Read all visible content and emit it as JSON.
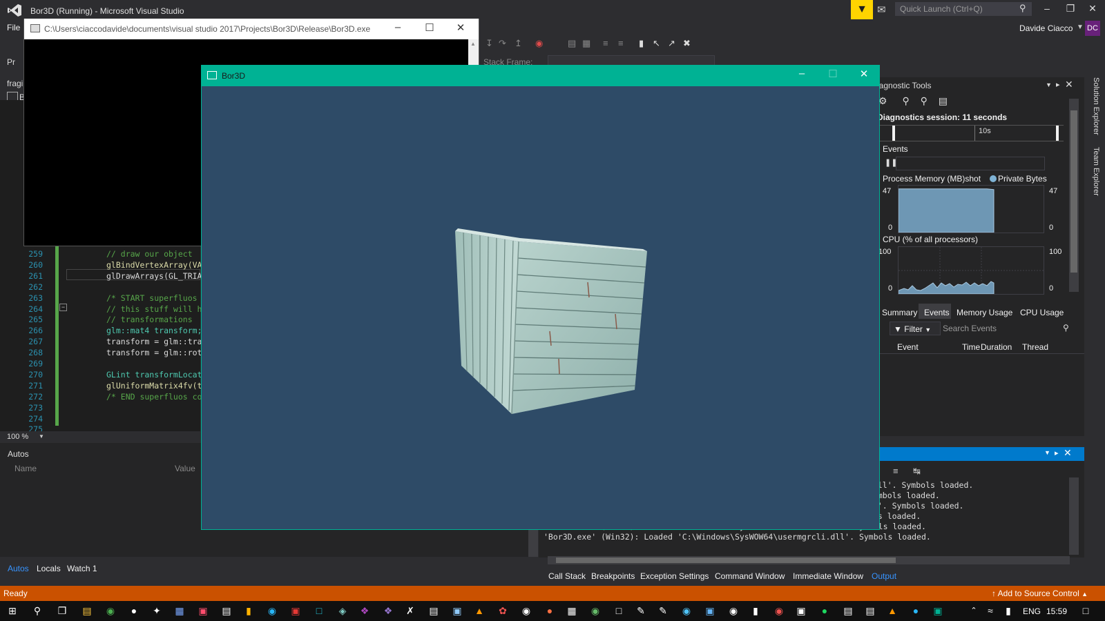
{
  "vs": {
    "title": "Bor3D (Running) - Microsoft Visual Studio",
    "quick_launch_placeholder": "Quick Launch (Ctrl+Q)",
    "menu_file": "File",
    "user_name": "Davide Ciacco",
    "user_initials": "DC",
    "stack_frame_label": "Stack Frame:",
    "left_tab_prefix": "Pr",
    "left_file_prefix": "fragi",
    "left_doc_letter": "B"
  },
  "editor": {
    "lines": [
      {
        "num": "259",
        "text": "// draw our object",
        "kind": "cmt"
      },
      {
        "num": "260",
        "text": "glBindVertexArray(VA",
        "kind": "fn"
      },
      {
        "num": "261",
        "text": "glDrawArrays(GL_TRIA",
        "kind": "plain"
      },
      {
        "num": "262",
        "text": "",
        "kind": "plain"
      },
      {
        "num": "263",
        "text": "/* START superfluos",
        "kind": "cmt"
      },
      {
        "num": "264",
        "text": "// this stuff will h",
        "kind": "cmt"
      },
      {
        "num": "265",
        "text": "// transformations",
        "kind": "cmt"
      },
      {
        "num": "266",
        "text": "glm::mat4 transform;",
        "kind": "typ"
      },
      {
        "num": "267",
        "text": "transform = glm::tra",
        "kind": "plain"
      },
      {
        "num": "268",
        "text": "transform = glm::rot",
        "kind": "plain"
      },
      {
        "num": "269",
        "text": "",
        "kind": "plain"
      },
      {
        "num": "270",
        "text": "GLint transformLocat",
        "kind": "typ"
      },
      {
        "num": "271",
        "text": "glUniformMatrix4fv(t",
        "kind": "fn"
      },
      {
        "num": "272",
        "text": "/* END superfluos co",
        "kind": "cmt"
      },
      {
        "num": "273",
        "text": "",
        "kind": "plain"
      },
      {
        "num": "274",
        "text": "",
        "kind": "plain"
      },
      {
        "num": "275",
        "text": "",
        "kind": "plain"
      }
    ],
    "zoom": "100 %"
  },
  "autos": {
    "title": "Autos",
    "col_name": "Name",
    "col_value": "Value",
    "tabs": [
      "Autos",
      "Locals",
      "Watch 1"
    ]
  },
  "output": {
    "lines": [
      ".dll'. Symbols loaded.",
      "Symbols loaded.",
      "ll'. Symbols loaded.",
      "ols loaded.",
      "'Bor3D.exe' (Win32): Loaded 'C:\\Windows\\SysWOW64\\winmmbase.dll'. Symbols loaded.",
      "'Bor3D.exe' (Win32): Loaded 'C:\\Windows\\SysWOW64\\usermgrcli.dll'. Symbols loaded."
    ],
    "tabs": [
      "Call Stack",
      "Breakpoints",
      "Exception Settings",
      "Command Window",
      "Immediate Window",
      "Output"
    ]
  },
  "diagnostics": {
    "title": "iagnostic Tools",
    "session": "Diagnostics session: 11 seconds",
    "timeline_mark": "10s",
    "events_label": "Events",
    "memory_label": "Process Memory (MB)",
    "memory_trailing": "shot",
    "private_bytes": "Private Bytes",
    "memory_max": "47",
    "memory_min": "0",
    "memory_level": 0.93,
    "cpu_label": "CPU (% of all processors)",
    "cpu_max": "100",
    "cpu_min": "0",
    "tabs": [
      "Summary",
      "Events",
      "Memory Usage",
      "CPU Usage"
    ],
    "filter_label": "Filter",
    "search_placeholder": "Search Events",
    "events_columns": [
      "Event",
      "Time",
      "Duration",
      "Thread"
    ]
  },
  "side_tabs": [
    "Solution Explorer",
    "Team Explorer"
  ],
  "console": {
    "title": "C:\\Users\\ciaccodavide\\documents\\visual studio 2017\\Projects\\Bor3D\\Release\\Bor3D.exe"
  },
  "bor3d": {
    "title": "Bor3D"
  },
  "status": {
    "ready": "Ready",
    "source_control": "Add to Source Control"
  },
  "taskbar": {
    "lang": "ENG",
    "clock": "15:59"
  },
  "colors": {
    "vs_accent": "#007acc",
    "status_bar": "#ca5100",
    "bor3d_frame": "#00b294",
    "bor3d_background": "#2e4b67",
    "filter_yellow": "#ffd400"
  }
}
